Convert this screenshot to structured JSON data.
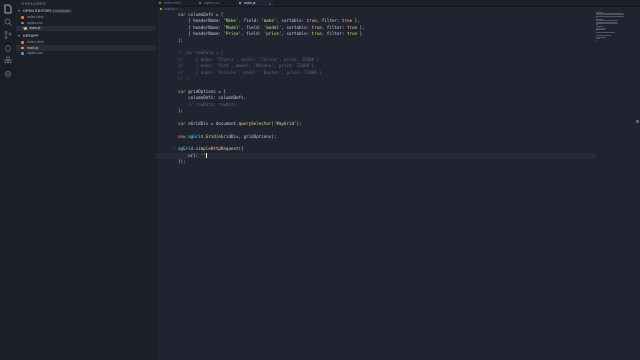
{
  "sidebar": {
    "title": "EXPLORER",
    "open_editors": {
      "label": "OPEN EDITORS",
      "badge": "1 UNSAVED",
      "files": [
        {
          "name": "index.html",
          "color": "#e37933",
          "active": false
        },
        {
          "name": "styles.css",
          "color": "#519aba",
          "active": false
        },
        {
          "name": "main.js",
          "color": "#d4b43a",
          "active": true
        }
      ]
    },
    "project": {
      "label": "DEFAPP",
      "files": [
        {
          "name": "index.html",
          "color": "#e37933",
          "active": false
        },
        {
          "name": "main.js",
          "color": "#d4b43a",
          "active": true
        },
        {
          "name": "styles.css",
          "color": "#519aba",
          "active": false
        }
      ]
    }
  },
  "tabs": [
    {
      "name": "index.html",
      "color": "#e37933",
      "active": false
    },
    {
      "name": "styles.css",
      "color": "#519aba",
      "active": false
    },
    {
      "name": "main.js",
      "color": "#d4b43a",
      "active": true,
      "close": "×"
    }
  ],
  "breadcrumb": "main.js > ...",
  "editor": {
    "current_line_number": "22",
    "line_numbers": [
      "",
      "",
      "",
      "",
      "",
      "",
      "",
      "",
      "",
      "",
      "",
      "",
      "",
      "",
      "",
      "",
      "",
      "",
      "",
      "",
      "",
      "22",
      ""
    ],
    "lines": [
      [
        {
          "t": "var ",
          "c": "kw"
        },
        {
          "t": "columnDefs = [",
          "c": "var"
        }
      ],
      [
        {
          "t": "    { headerName: ",
          "c": "var"
        },
        {
          "t": "'Make'",
          "c": "str"
        },
        {
          "t": ", field: ",
          "c": "var"
        },
        {
          "t": "'make'",
          "c": "str"
        },
        {
          "t": ", sortable: ",
          "c": "var"
        },
        {
          "t": "true",
          "c": "bool"
        },
        {
          "t": ", filter: ",
          "c": "var"
        },
        {
          "t": "true",
          "c": "bool"
        },
        {
          "t": " },",
          "c": "var"
        }
      ],
      [
        {
          "t": "    { headerName: ",
          "c": "var"
        },
        {
          "t": "'Model'",
          "c": "str"
        },
        {
          "t": ", field: ",
          "c": "var"
        },
        {
          "t": "'model'",
          "c": "str"
        },
        {
          "t": ", sortable: ",
          "c": "var"
        },
        {
          "t": "true",
          "c": "bool"
        },
        {
          "t": ", filter: ",
          "c": "var"
        },
        {
          "t": "true",
          "c": "bool"
        },
        {
          "t": " },",
          "c": "var"
        }
      ],
      [
        {
          "t": "    { headerName: ",
          "c": "var"
        },
        {
          "t": "'Price'",
          "c": "str"
        },
        {
          "t": ", field: ",
          "c": "var"
        },
        {
          "t": "'price'",
          "c": "str"
        },
        {
          "t": ", sortable: ",
          "c": "var"
        },
        {
          "t": "true",
          "c": "bool"
        },
        {
          "t": ", filter: ",
          "c": "var"
        },
        {
          "t": "true",
          "c": "bool"
        },
        {
          "t": " }",
          "c": "var"
        }
      ],
      [
        {
          "t": "];",
          "c": "var"
        }
      ],
      [],
      [
        {
          "t": "// var rowData = [",
          "c": "cm"
        }
      ],
      [
        {
          "t": "//     { make: 'Toyota', model: 'Celica', price: 35000 },",
          "c": "cm"
        }
      ],
      [
        {
          "t": "//     { make: 'Ford', model: 'Mondeo', price: 32000 },",
          "c": "cm"
        }
      ],
      [
        {
          "t": "//     { make: 'Porsche', model: 'Boxter', price: 72000 }",
          "c": "cm"
        }
      ],
      [
        {
          "t": "// ];",
          "c": "cm"
        }
      ],
      [],
      [
        {
          "t": "var ",
          "c": "kw"
        },
        {
          "t": "gridOptions = {",
          "c": "var"
        }
      ],
      [
        {
          "t": "    columnDefs: columnDefs,",
          "c": "var"
        }
      ],
      [
        {
          "t": "    // rowData: rowData",
          "c": "cm"
        }
      ],
      [
        {
          "t": "};",
          "c": "var"
        }
      ],
      [],
      [
        {
          "t": "var ",
          "c": "kw"
        },
        {
          "t": "eGridDiv = document.",
          "c": "var"
        },
        {
          "t": "querySelector",
          "c": "fn"
        },
        {
          "t": "(",
          "c": "var"
        },
        {
          "t": "'#myGrid'",
          "c": "str"
        },
        {
          "t": ");",
          "c": "var"
        }
      ],
      [],
      [
        {
          "t": "new ",
          "c": "kw"
        },
        {
          "t": "agGrid",
          "c": "ident"
        },
        {
          "t": ".",
          "c": "var"
        },
        {
          "t": "Grid",
          "c": "fn"
        },
        {
          "t": "(eGridDiv, gridOptions);",
          "c": "var"
        }
      ],
      [],
      [
        {
          "t": "agGrid",
          "c": "ident"
        },
        {
          "t": ".",
          "c": "var"
        },
        {
          "t": "simpleHttpRequest",
          "c": "fn"
        },
        {
          "t": "({",
          "c": "var"
        }
      ],
      [
        {
          "t": "    url: ",
          "c": "var"
        },
        {
          "t": "''",
          "c": "str"
        }
      ],
      [
        {
          "t": "});",
          "c": "var"
        }
      ]
    ],
    "cursor_line": 22
  },
  "colors": {
    "background": "#1f2430",
    "sidebar": "#1c2029",
    "activity_bar": "#1a1e27",
    "accent": "#ffcc66"
  },
  "icons": [
    "files-icon",
    "search-icon",
    "source-control-icon",
    "debug-icon",
    "extensions-icon",
    "settings-icon"
  ]
}
